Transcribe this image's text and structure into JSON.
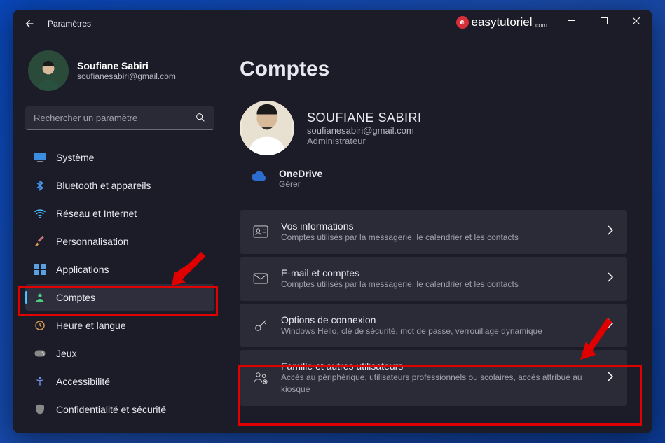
{
  "window": {
    "title": "Paramètres",
    "brand": "easytutoriel",
    "brand_suffix": ".com"
  },
  "profile": {
    "name": "Soufiane Sabiri",
    "email": "soufianesabiri@gmail.com"
  },
  "search": {
    "placeholder": "Rechercher un paramètre"
  },
  "nav": {
    "system": "Système",
    "bluetooth": "Bluetooth et appareils",
    "network": "Réseau et Internet",
    "personalization": "Personnalisation",
    "apps": "Applications",
    "accounts": "Comptes",
    "time": "Heure et langue",
    "gaming": "Jeux",
    "accessibility": "Accessibilité",
    "privacy": "Confidentialité et sécurité"
  },
  "page": {
    "title": "Comptes",
    "account_name": "SOUFIANE SABIRI",
    "account_email": "soufianesabiri@gmail.com",
    "account_role": "Administrateur",
    "onedrive_title": "OneDrive",
    "onedrive_sub": "Gérer"
  },
  "cards": {
    "info_title": "Vos informations",
    "info_sub": "Comptes utilisés par la messagerie, le calendrier et les contacts",
    "email_title": "E-mail et comptes",
    "email_sub": "Comptes utilisés par la messagerie, le calendrier et les contacts",
    "signin_title": "Options de connexion",
    "signin_sub": "Windows Hello, clé de sécurité, mot de passe, verrouillage dynamique",
    "family_title": "Famille et autres utilisateurs",
    "family_sub": "Accès au périphérique, utilisateurs professionnels ou scolaires, accès attribué au kiosque"
  }
}
